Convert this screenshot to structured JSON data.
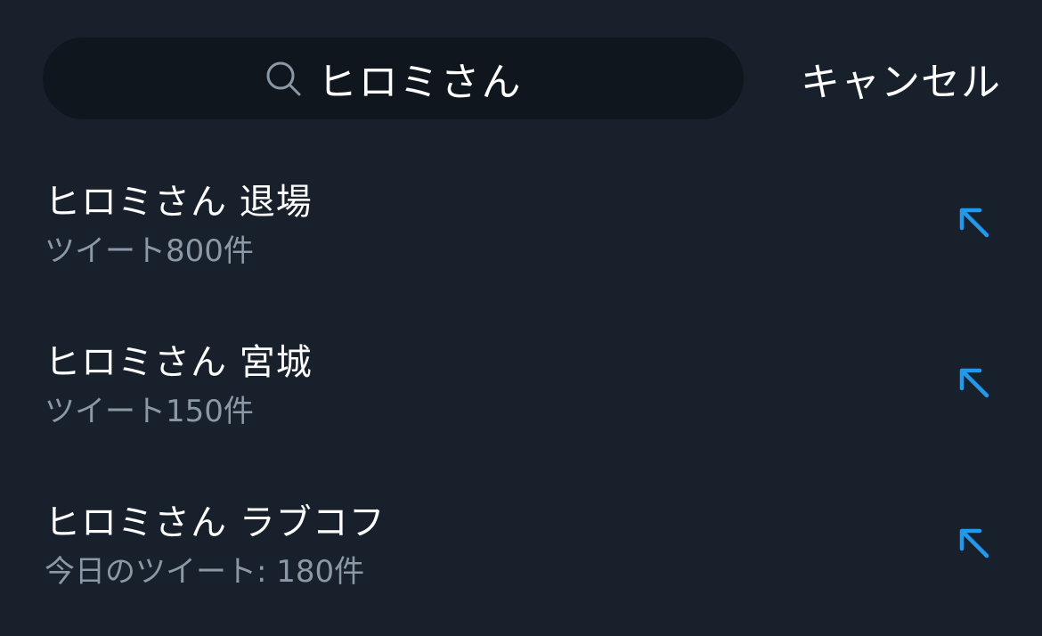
{
  "search": {
    "query": "ヒロミさん",
    "icon": "search-icon",
    "cancel_label": "キャンセル"
  },
  "suggestions": [
    {
      "title": "ヒロミさん 退場",
      "subtitle": "ツイート800件",
      "icon": "arrow-up-left-icon"
    },
    {
      "title": "ヒロミさん 宮城",
      "subtitle": "ツイート150件",
      "icon": "arrow-up-left-icon"
    },
    {
      "title": "ヒロミさん ラブコフ",
      "subtitle": "今日のツイート: 180件",
      "icon": "arrow-up-left-icon"
    }
  ],
  "colors": {
    "background": "#17202b",
    "search_field": "#10161e",
    "text_primary": "#ffffff",
    "text_secondary": "#8b98a5",
    "accent": "#1d9bf0",
    "icon_muted": "#8b98a5"
  }
}
